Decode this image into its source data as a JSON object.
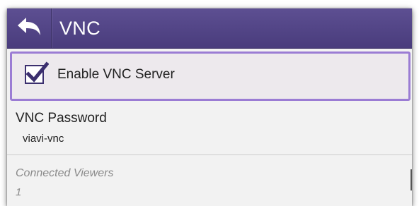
{
  "header": {
    "title": "VNC",
    "back_icon": "back-arrow-icon"
  },
  "enable_server": {
    "label": "Enable VNC Server",
    "checked": true
  },
  "password": {
    "title": "VNC Password",
    "value": "viavi-vnc"
  },
  "viewers": {
    "title": "Connected Viewers",
    "value": "1"
  },
  "colors": {
    "header": "#4f4285",
    "accent": "#9b7cd4",
    "checkbox": "#3b2f6e"
  }
}
